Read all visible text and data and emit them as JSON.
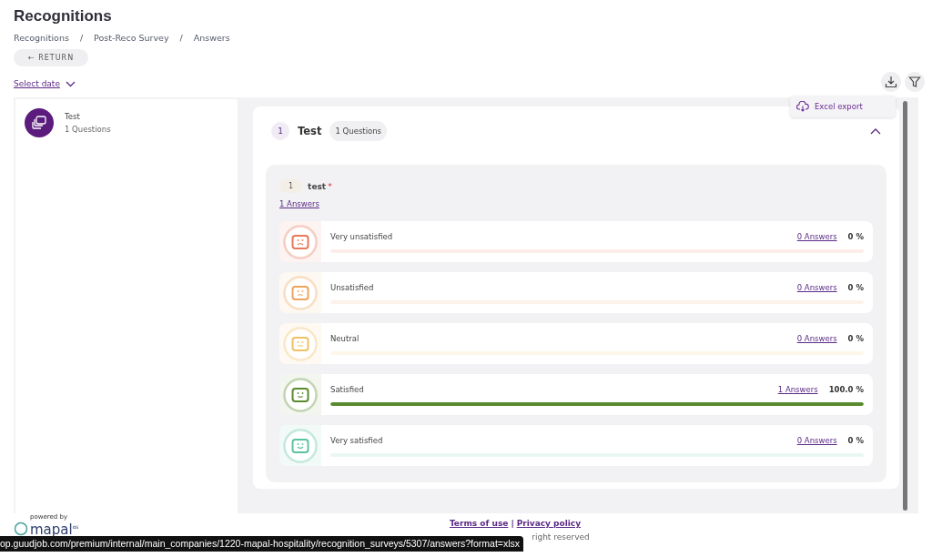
{
  "page_title": "Recognitions",
  "breadcrumbs": [
    "Recognitions",
    "Post-Reco Survey",
    "Answers"
  ],
  "breadcrumb_separator": "/",
  "return_button": "← RETURN",
  "date_filter": "Select date",
  "export_menu": {
    "item": "Excel export"
  },
  "sidebar": {
    "items": [
      {
        "title": "Test",
        "subtitle": "1 Questions",
        "selected": true
      }
    ]
  },
  "survey": {
    "number": "1",
    "title": "Test",
    "badge": "1 Questions",
    "expanded": true,
    "question": {
      "number": "1",
      "text": "test",
      "required": true,
      "required_mark": "*",
      "answers_link": "1 Answers",
      "options": [
        {
          "kind": "very-unsatisfied",
          "label": "Very unsatisfied",
          "answers": "0 Answers",
          "percent": "0 %",
          "level": 0,
          "color": "#e8795a"
        },
        {
          "kind": "unsatisfied",
          "label": "Unsatisfied",
          "answers": "0 Answers",
          "percent": "0 %",
          "level": 0,
          "color": "#eea45e"
        },
        {
          "kind": "neutral",
          "label": "Neutral",
          "answers": "0 Answers",
          "percent": "0 %",
          "level": 0,
          "color": "#efc064"
        },
        {
          "kind": "satisfied",
          "label": "Satisfied",
          "answers": "1 Answers",
          "percent": "100.0 %",
          "level": 1,
          "color": "#5a8a2e"
        },
        {
          "kind": "very-satisfied",
          "label": "Very satisfied",
          "answers": "0 Answers",
          "percent": "0 %",
          "level": 0,
          "color": "#5cc3a0"
        }
      ]
    }
  },
  "footer": {
    "powered_by": "powered by",
    "logo": "mapal",
    "logo_suffix": "os",
    "links": [
      "Terms of use",
      "Privacy policy"
    ],
    "separator": "|",
    "copyright": "right reserved"
  },
  "status_url": "op.guudjob.com/premium/internal/main_companies/1220-mapal-hospitality/recognition_surveys/5307/answers?format=xlsx"
}
